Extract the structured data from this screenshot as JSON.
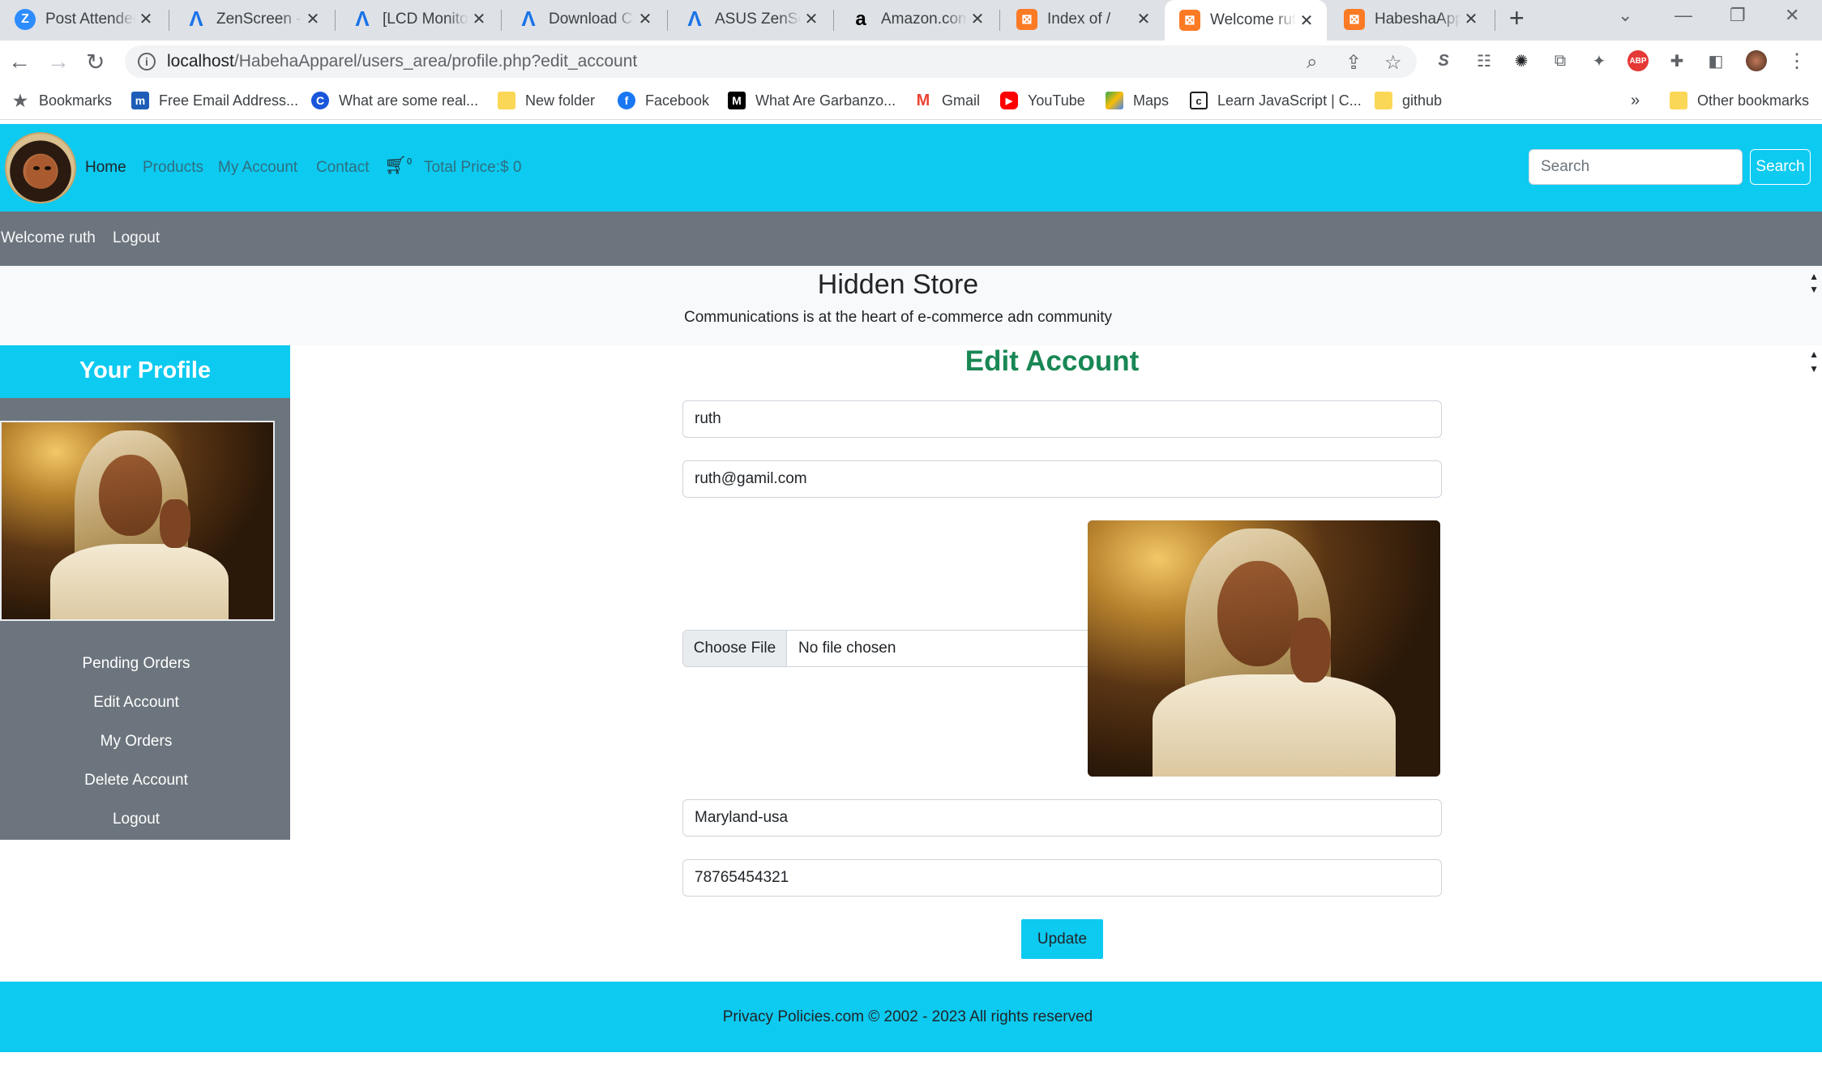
{
  "browser": {
    "tabs": [
      {
        "title": "Post Attendee",
        "icon": "zoom-icon",
        "color": "#2d8cff"
      },
      {
        "title": "ZenScreen - ASUS",
        "icon": "asus-icon",
        "color": "#1a73e8"
      },
      {
        "title": "[LCD Monitor]",
        "icon": "asus-icon",
        "color": "#1a73e8"
      },
      {
        "title": "Download Center",
        "icon": "asus-icon",
        "color": "#1a73e8"
      },
      {
        "title": "ASUS ZenScreen",
        "icon": "asus-icon",
        "color": "#1a73e8"
      },
      {
        "title": "Amazon.com",
        "icon": "amazon-icon",
        "color": "#000000"
      },
      {
        "title": "Index of /",
        "icon": "xampp-icon",
        "color": "#fb7a24"
      },
      {
        "title": "Welcome ruth",
        "icon": "xampp-icon",
        "color": "#fb7a24"
      },
      {
        "title": "HabeshaApparel",
        "icon": "xampp-icon",
        "color": "#fb7a24"
      }
    ],
    "active_tab_index": 7,
    "url_host": "localhost",
    "url_path": "/HabehaApparel/users_area/profile.php?edit_account",
    "bookmarks": [
      {
        "label": "Bookmarks",
        "icon": "star-icon"
      },
      {
        "label": "Free Email Address...",
        "icon": "mailinator-icon"
      },
      {
        "label": "What are some real...",
        "icon": "c-icon"
      },
      {
        "label": "New folder",
        "icon": "folder-icon"
      },
      {
        "label": "Facebook",
        "icon": "facebook-icon"
      },
      {
        "label": "What Are Garbanzo...",
        "icon": "medium-icon"
      },
      {
        "label": "Gmail",
        "icon": "gmail-icon"
      },
      {
        "label": "YouTube",
        "icon": "youtube-icon"
      },
      {
        "label": "Maps",
        "icon": "maps-icon"
      },
      {
        "label": "Learn JavaScript | C...",
        "icon": "codecademy-icon"
      },
      {
        "label": "github",
        "icon": "folder-icon"
      }
    ],
    "overflow": "»",
    "other_bookmarks": "Other bookmarks"
  },
  "nav": {
    "home": "Home",
    "products": "Products",
    "my_account": "My Account",
    "contact": "Contact",
    "cart_count": "0",
    "total_price": "Total Price:$ 0",
    "search_placeholder": "Search",
    "search_button": "Search"
  },
  "welcome": {
    "text": "Welcome ruth",
    "logout": "Logout"
  },
  "store": {
    "title": "Hidden Store",
    "subtitle": "Communications is at the heart of e-commerce adn community"
  },
  "sidebar": {
    "heading": "Your Profile",
    "links": [
      "Pending Orders",
      "Edit Account",
      "My Orders",
      "Delete Account",
      "Logout"
    ]
  },
  "form": {
    "title": "Edit Account",
    "username": "ruth",
    "email": "ruth@gamil.com",
    "file_button": "Choose File",
    "file_status": "No file chosen",
    "address": "Maryland-usa",
    "phone": "78765454321",
    "submit": "Update"
  },
  "footer": {
    "text": "Privacy Policies.com © 2002 - 2023 All rights reserved"
  },
  "colors": {
    "brand": "#0dcaf0",
    "secondary": "#6c757d",
    "title_green": "#198754"
  }
}
